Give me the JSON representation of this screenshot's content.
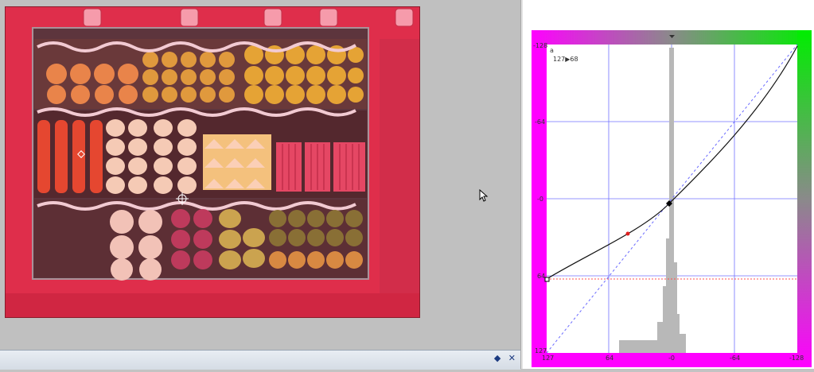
{
  "curve_panel": {
    "channel": "a",
    "readout": "127▶68",
    "left_ticks": [
      "-128",
      "-64",
      "-0",
      "64",
      "127"
    ],
    "bottom_ticks": [
      "127",
      "64",
      "-0",
      "-64",
      "-128"
    ],
    "colors": {
      "gradient_left": "#ff00ff",
      "gradient_right": "#00ee00",
      "grid": "#6f6fff",
      "curve": "#111111",
      "histogram": "#b0b0b0",
      "guide": "#ff5050"
    }
  },
  "bottom_panel": {
    "pin_icon": "pin-icon",
    "close_icon": "close-icon",
    "pin_glyph": "◆",
    "close_glyph": "✕"
  },
  "canvas": {
    "background": "#c0c0c0",
    "photo_tint": "#d6334f"
  }
}
